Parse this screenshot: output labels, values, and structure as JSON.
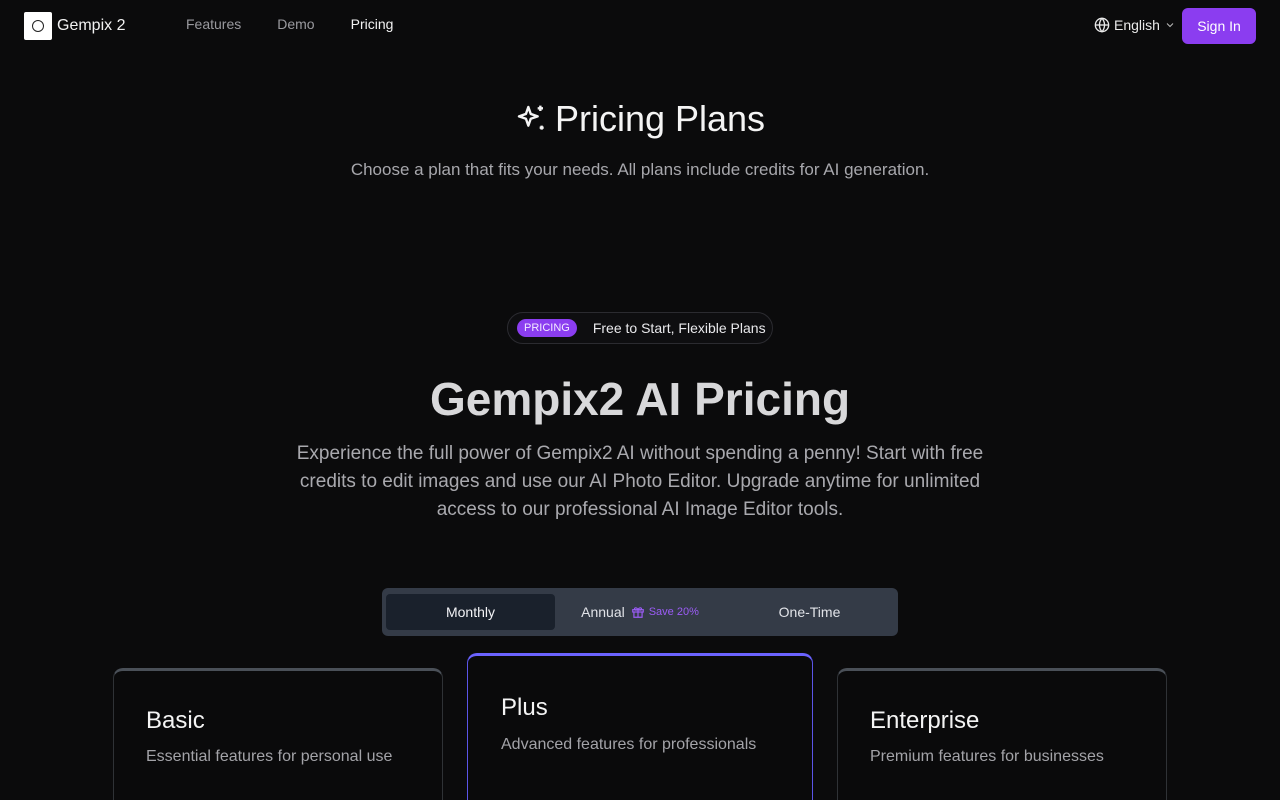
{
  "header": {
    "brand": "Gempix 2",
    "nav": [
      "Features",
      "Demo",
      "Pricing"
    ],
    "active_nav": "Pricing",
    "language": "English",
    "sign_in": "Sign In"
  },
  "hero": {
    "title": "Pricing Plans",
    "subtitle": "Choose a plan that fits your needs. All plans include credits for AI generation."
  },
  "pricing_section": {
    "badge": "PRICING",
    "badge_text": "Free to Start, Flexible Plans",
    "title": "Gempix2 AI Pricing",
    "description": "Experience the full power of Gempix2 AI without spending a penny! Start with free credits to edit images and use our AI Photo Editor. Upgrade anytime for unlimited access to our professional AI Image Editor tools."
  },
  "billing_toggle": {
    "options": [
      "Monthly",
      "Annual",
      "One-Time"
    ],
    "selected": "Monthly",
    "annual_save": "Save 20%"
  },
  "plans": [
    {
      "name": "Basic",
      "description": "Essential features for personal use"
    },
    {
      "name": "Plus",
      "description": "Advanced features for professionals",
      "highlighted": true
    },
    {
      "name": "Enterprise",
      "description": "Premium features for businesses"
    }
  ],
  "colors": {
    "background": "#0b0b0c",
    "accent": "#8b3df0",
    "highlight_border": "#6b63ff",
    "toggle_bg": "#343b47"
  },
  "icons": {
    "logo": "logo-ring-icon",
    "language": "globe-icon",
    "language_caret": "chevron-down-icon",
    "hero": "sparkles-icon",
    "save": "gift-icon"
  }
}
